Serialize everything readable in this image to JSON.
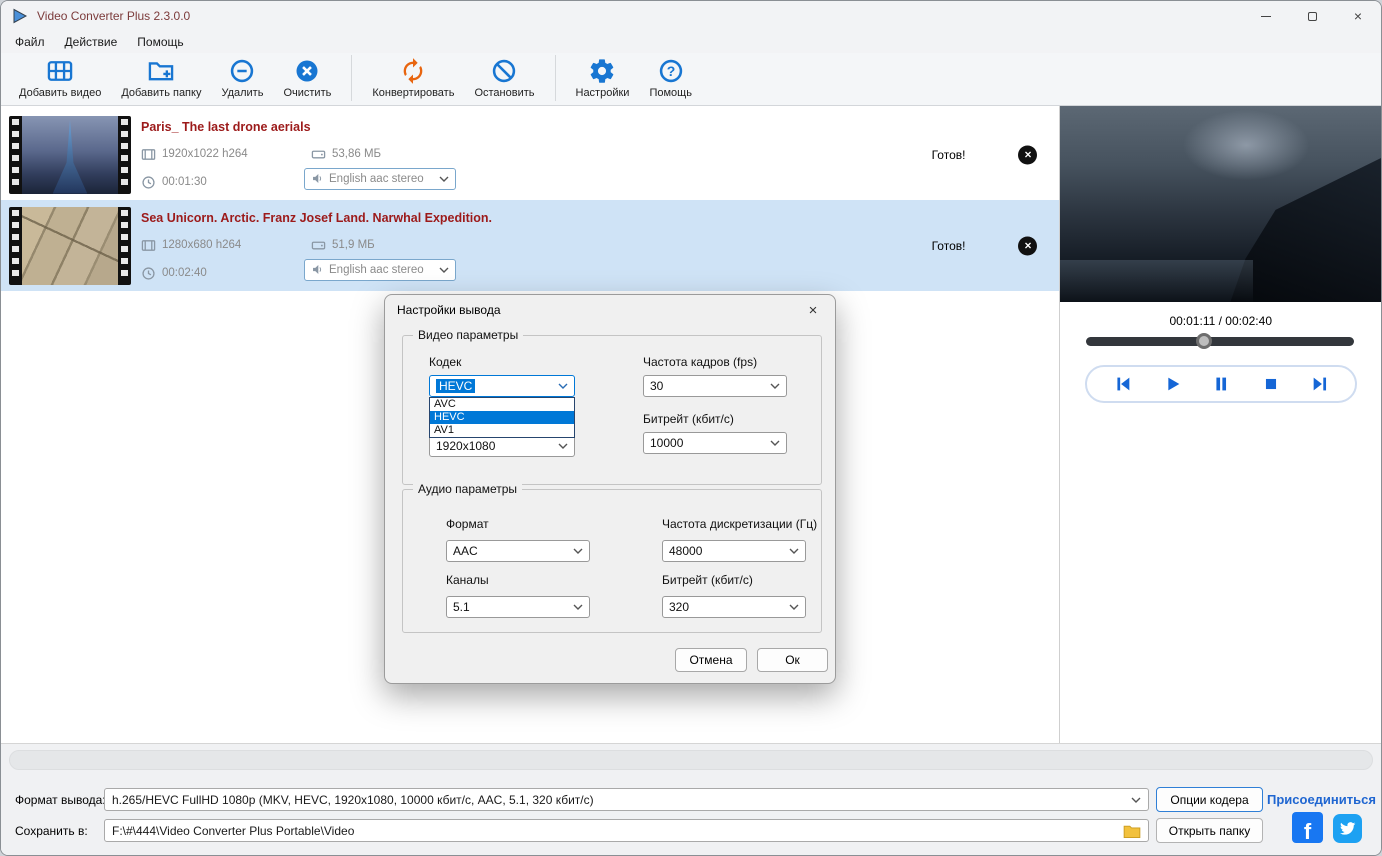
{
  "window": {
    "title": "Video Converter Plus 2.3.0.0"
  },
  "menu": {
    "items": [
      "Файл",
      "Действие",
      "Помощь"
    ]
  },
  "toolbar": {
    "buttons": [
      {
        "label": "Добавить видео",
        "icon": "add-video"
      },
      {
        "label": "Добавить папку",
        "icon": "add-folder"
      },
      {
        "label": "Удалить",
        "icon": "remove-circle"
      },
      {
        "label": "Очистить",
        "icon": "clear-circle-x"
      },
      {
        "label": "Конвертировать",
        "icon": "convert-arrows"
      },
      {
        "label": "Остановить",
        "icon": "prohibition-circle"
      },
      {
        "label": "Настройки",
        "icon": "gear"
      },
      {
        "label": "Помощь",
        "icon": "question-circle"
      }
    ]
  },
  "file_list": [
    {
      "title": "Paris_ The last drone aerials",
      "resolution": "1920x1022 h264",
      "size": "53,86 МБ",
      "duration": "00:01:30",
      "audio": "English aac stereo",
      "status": "Готов!",
      "selected": false
    },
    {
      "title": "Sea Unicorn. Arctic. Franz Josef Land. Narwhal Expedition.",
      "resolution": "1280x680 h264",
      "size": "51,9 МБ",
      "duration": "00:02:40",
      "audio": "English aac stereo",
      "status": "Готов!",
      "selected": true
    }
  ],
  "player": {
    "time_display": "00:01:11 / 00:02:40",
    "progress_percent": 44
  },
  "dialog": {
    "title": "Настройки вывода",
    "video": {
      "legend": "Видео параметры",
      "codec_label": "Кодек",
      "codec_value": "HEVC",
      "codec_options": [
        "AVC",
        "HEVC",
        "AV1"
      ],
      "highlighted_option": "HEVC",
      "fps_label": "Частота кадров (fps)",
      "fps_value": "30",
      "resolution_value": "1920x1080",
      "bitrate_label": "Битрейт (кбит/с)",
      "bitrate_value": "10000"
    },
    "audio": {
      "legend": "Аудио параметры",
      "format_label": "Формат",
      "format_value": "AAC",
      "samplerate_label": "Частота дискретизации (Гц)",
      "samplerate_value": "48000",
      "channels_label": "Каналы",
      "channels_value": "5.1",
      "bitrate_label": "Битрейт (кбит/с)",
      "bitrate_value": "320"
    },
    "cancel_label": "Отмена",
    "ok_label": "Ок"
  },
  "bottom": {
    "format_label": "Формат вывода:",
    "format_value": "h.265/HEVC FullHD 1080p (MKV, HEVC, 1920x1080, 10000 кбит/с, AAC, 5.1, 320 кбит/с)",
    "encoder_button": "Опции кодера",
    "join_link": "Присоединиться",
    "save_label": "Сохранить в:",
    "save_path": "F:\\#\\444\\Video Converter Plus Portable\\Video",
    "open_folder_button": "Открыть папку"
  },
  "colors": {
    "accent_blue": "#1876d2",
    "convert_orange": "#e8650f",
    "selection_blue": "#0078d7",
    "row_title_red": "#9c1a1a",
    "selected_row": "#cfe3f6",
    "facebook_blue": "#1877f2",
    "twitter_blue": "#1da1f2"
  }
}
